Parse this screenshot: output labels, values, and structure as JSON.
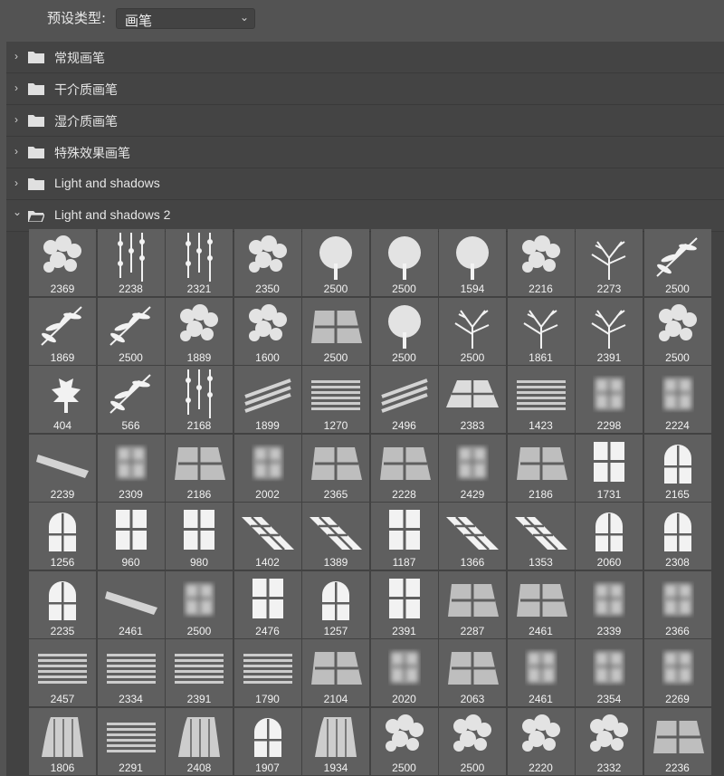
{
  "preset": {
    "label": "预设类型:",
    "value": "画笔"
  },
  "groups": [
    {
      "name": "常规画笔",
      "expanded": false
    },
    {
      "name": "干介质画笔",
      "expanded": false
    },
    {
      "name": "湿介质画笔",
      "expanded": false
    },
    {
      "name": "特殊效果画笔",
      "expanded": false
    },
    {
      "name": "Light and shadows",
      "expanded": false
    },
    {
      "name": "Light and shadows 2",
      "expanded": true
    }
  ],
  "brushes": [
    [
      {
        "size": "2369",
        "icon": "foliage-icon"
      },
      {
        "size": "2238",
        "icon": "hanging-vines-icon"
      },
      {
        "size": "2321",
        "icon": "vine-icon"
      },
      {
        "size": "2350",
        "icon": "foliage-icon"
      },
      {
        "size": "2500",
        "icon": "tree-canopy-icon"
      },
      {
        "size": "2500",
        "icon": "tree-icon"
      },
      {
        "size": "1594",
        "icon": "tree-icon"
      },
      {
        "size": "2216",
        "icon": "foliage-icon"
      },
      {
        "size": "2273",
        "icon": "branches-shadow-icon"
      },
      {
        "size": "2500",
        "icon": "palm-leaves-icon"
      }
    ],
    [
      {
        "size": "1869",
        "icon": "palm-leaf-icon"
      },
      {
        "size": "2500",
        "icon": "palm-leaves-icon"
      },
      {
        "size": "1889",
        "icon": "foliage-icon"
      },
      {
        "size": "1600",
        "icon": "foliage-icon"
      },
      {
        "size": "2500",
        "icon": "window-light-icon"
      },
      {
        "size": "2500",
        "icon": "bush-icon"
      },
      {
        "size": "2500",
        "icon": "bare-tree-icon"
      },
      {
        "size": "1861",
        "icon": "twig-icon"
      },
      {
        "size": "2391",
        "icon": "bare-tree-icon"
      },
      {
        "size": "2500",
        "icon": "foliage-icon"
      }
    ],
    [
      {
        "size": "404",
        "icon": "maple-leaf-icon"
      },
      {
        "size": "566",
        "icon": "leaf-sprig-icon"
      },
      {
        "size": "2168",
        "icon": "hanging-leaves-icon"
      },
      {
        "size": "1899",
        "icon": "light-streaks-icon"
      },
      {
        "size": "1270",
        "icon": "blinds-light-icon"
      },
      {
        "size": "2496",
        "icon": "light-streaks-icon"
      },
      {
        "size": "2383",
        "icon": "window-grid-light-icon"
      },
      {
        "size": "1423",
        "icon": "blinds-light-icon"
      },
      {
        "size": "2298",
        "icon": "window-blur-icon"
      },
      {
        "size": "2224",
        "icon": "window-blur-icon"
      }
    ],
    [
      {
        "size": "2239",
        "icon": "light-beam-icon"
      },
      {
        "size": "2309",
        "icon": "window-blur-icon"
      },
      {
        "size": "2186",
        "icon": "window-light-icon"
      },
      {
        "size": "2002",
        "icon": "window-blur-icon"
      },
      {
        "size": "2365",
        "icon": "window-light-icon"
      },
      {
        "size": "2228",
        "icon": "window-light-icon"
      },
      {
        "size": "2429",
        "icon": "window-blur-icon"
      },
      {
        "size": "2186",
        "icon": "window-light-icon"
      },
      {
        "size": "1731",
        "icon": "window-grid-icon"
      },
      {
        "size": "2165",
        "icon": "arched-window-icon"
      }
    ],
    [
      {
        "size": "1256",
        "icon": "arched-window-icon"
      },
      {
        "size": "960",
        "icon": "window-grid-icon"
      },
      {
        "size": "980",
        "icon": "window-grid-icon"
      },
      {
        "size": "1402",
        "icon": "skewed-window-icon"
      },
      {
        "size": "1389",
        "icon": "skewed-window-icon"
      },
      {
        "size": "1187",
        "icon": "window-grid-icon"
      },
      {
        "size": "1366",
        "icon": "skewed-window-icon"
      },
      {
        "size": "1353",
        "icon": "skewed-window-icon"
      },
      {
        "size": "2060",
        "icon": "arched-window-icon"
      },
      {
        "size": "2308",
        "icon": "arched-window-icon"
      }
    ],
    [
      {
        "size": "2235",
        "icon": "arched-window-icon"
      },
      {
        "size": "2461",
        "icon": "light-beam-icon"
      },
      {
        "size": "2500",
        "icon": "window-blur-icon"
      },
      {
        "size": "2476",
        "icon": "window-grid-icon"
      },
      {
        "size": "1257",
        "icon": "arched-window-icon"
      },
      {
        "size": "2391",
        "icon": "window-grid-icon"
      },
      {
        "size": "2287",
        "icon": "window-light-icon"
      },
      {
        "size": "2461",
        "icon": "window-light-icon"
      },
      {
        "size": "2339",
        "icon": "window-blur-icon"
      },
      {
        "size": "2366",
        "icon": "window-blur-icon"
      }
    ],
    [
      {
        "size": "2457",
        "icon": "blinds-light-icon"
      },
      {
        "size": "2334",
        "icon": "blinds-light-icon"
      },
      {
        "size": "2391",
        "icon": "blinds-light-icon"
      },
      {
        "size": "1790",
        "icon": "blinds-light-icon"
      },
      {
        "size": "2104",
        "icon": "window-light-icon"
      },
      {
        "size": "2020",
        "icon": "window-blur-icon"
      },
      {
        "size": "2063",
        "icon": "window-light-icon"
      },
      {
        "size": "2461",
        "icon": "window-blur-icon"
      },
      {
        "size": "2354",
        "icon": "window-blur-icon"
      },
      {
        "size": "2269",
        "icon": "window-blur-icon"
      }
    ],
    [
      {
        "size": "1806",
        "icon": "curtain-light-icon"
      },
      {
        "size": "2291",
        "icon": "blinds-light-icon"
      },
      {
        "size": "2408",
        "icon": "curtain-light-icon"
      },
      {
        "size": "1907",
        "icon": "arched-window-icon"
      },
      {
        "size": "1934",
        "icon": "curtain-light-icon"
      },
      {
        "size": "2500",
        "icon": "foliage-icon"
      },
      {
        "size": "2500",
        "icon": "foliage-icon"
      },
      {
        "size": "2220",
        "icon": "foliage-icon"
      },
      {
        "size": "2332",
        "icon": "foliage-icon"
      },
      {
        "size": "2236",
        "icon": "window-light-icon"
      }
    ]
  ]
}
